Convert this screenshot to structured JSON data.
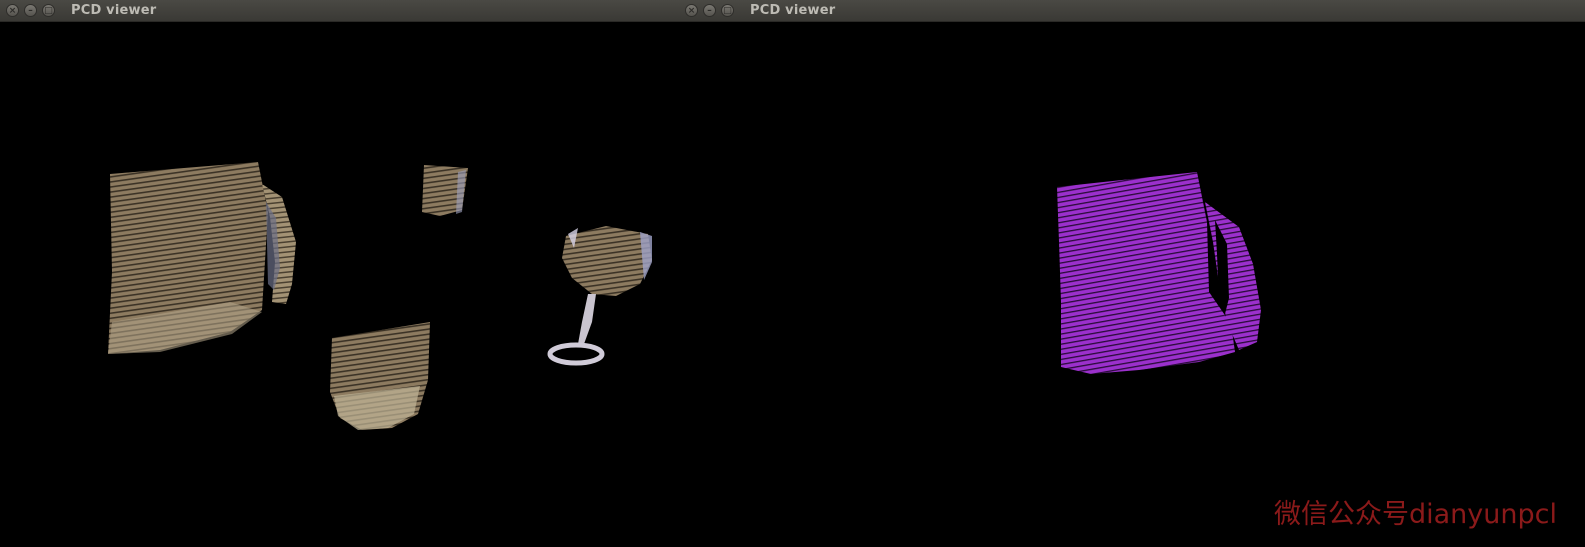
{
  "windows": [
    {
      "title": "PCD viewer",
      "buttons": [
        "close-icon",
        "minimize-icon",
        "maximize-icon"
      ],
      "point_color": "#8a7a60",
      "status_text": ""
    },
    {
      "title": "PCD viewer",
      "buttons": [
        "close-icon",
        "minimize-icon",
        "maximize-icon"
      ],
      "point_color": "#9a2fc8",
      "status_text": ""
    }
  ],
  "watermark": {
    "text": "微信公众号dianyunpcl",
    "color": "#8b1a1a"
  },
  "colors": {
    "background": "#000000",
    "titlebar": "#3f3e3a",
    "title_text": "#bdbbb4"
  }
}
